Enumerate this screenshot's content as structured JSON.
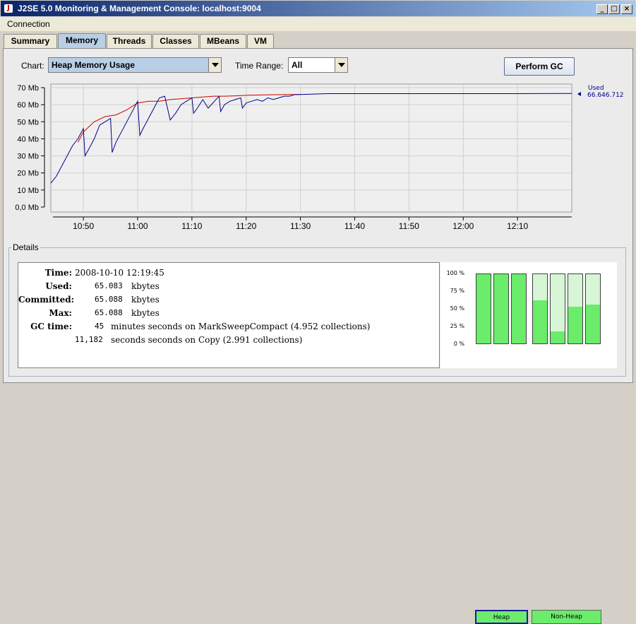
{
  "window": {
    "title": "J2SE 5.0 Monitoring & Management Console: localhost:9004",
    "icon": "java-icon"
  },
  "menu": {
    "items": [
      "Connection"
    ]
  },
  "tabs": [
    {
      "label": "Summary",
      "active": false
    },
    {
      "label": "Memory",
      "active": true
    },
    {
      "label": "Threads",
      "active": false
    },
    {
      "label": "Classes",
      "active": false
    },
    {
      "label": "MBeans",
      "active": false
    },
    {
      "label": "VM",
      "active": false
    }
  ],
  "controls": {
    "chart_label": "Chart:",
    "chart_value": "Heap Memory Usage",
    "time_range_label": "Time Range:",
    "time_range_value": "All",
    "gc_button": "Perform GC"
  },
  "chart_data": {
    "type": "line",
    "title": "",
    "xlabel": "",
    "ylabel": "",
    "y_ticks": [
      "70 Mb",
      "60 Mb",
      "50 Mb",
      "40 Mb",
      "30 Mb",
      "20 Mb",
      "10 Mb",
      "0,0 Mb"
    ],
    "y_tick_values": [
      70,
      60,
      50,
      40,
      30,
      20,
      10,
      0
    ],
    "x_ticks": [
      "10:50",
      "11:00",
      "11:10",
      "11:20",
      "11:30",
      "11:40",
      "11:50",
      "12:00",
      "12:10"
    ],
    "x_tick_minutes": [
      650,
      660,
      670,
      680,
      690,
      700,
      710,
      720,
      730
    ],
    "xlim_minutes": [
      644,
      740
    ],
    "ylim": [
      0,
      72
    ],
    "grid": true,
    "legend": {
      "label": "Used",
      "value": "66.646.712",
      "placement": "right"
    },
    "colors": {
      "used": "#00008b",
      "committed": "#cc0000"
    },
    "series": [
      {
        "name": "Used",
        "x": [
          644,
          645,
          646,
          647,
          648,
          649,
          650,
          650.3,
          651,
          652,
          653,
          654,
          655,
          655.3,
          656,
          657,
          658,
          659,
          660,
          660.4,
          661,
          662,
          663,
          664,
          665,
          666,
          667,
          668,
          670,
          670.3,
          671,
          672,
          673,
          675,
          675.3,
          676,
          677,
          678,
          679,
          679.3,
          680,
          681,
          682,
          683,
          684,
          685,
          686,
          687,
          688,
          689,
          690,
          695,
          700,
          710,
          720,
          730,
          740
        ],
        "y": [
          14,
          18,
          24,
          30,
          36,
          40,
          46,
          30,
          34,
          40,
          48,
          50,
          52,
          32,
          38,
          44,
          50,
          56,
          62,
          42,
          46,
          52,
          58,
          64,
          65,
          51,
          55,
          60,
          64,
          55,
          58,
          63,
          58,
          65,
          56,
          60,
          62,
          63,
          64,
          58,
          61,
          62,
          63,
          62,
          64,
          63,
          64,
          65,
          65,
          66,
          66,
          66.5,
          66.5,
          66.5,
          66.5,
          66.5,
          66.6
        ]
      },
      {
        "name": "Committed",
        "x": [
          649,
          650,
          652,
          654,
          656,
          658,
          660,
          662,
          664,
          666,
          668,
          670,
          672,
          674,
          676,
          678,
          680,
          684,
          688,
          690
        ],
        "y": [
          38,
          44,
          50,
          53,
          54,
          57,
          61,
          62,
          62,
          63,
          63.5,
          64,
          64.5,
          65,
          65,
          65.2,
          65.5,
          65.8,
          66,
          66
        ]
      }
    ]
  },
  "details": {
    "legend": "Details",
    "time_label": "Time:",
    "time_value": "2008-10-10 12:19:45",
    "used_label": "Used:",
    "used_value": "65.083",
    "used_unit": "kbytes",
    "committed_label": "Committed:",
    "committed_value": "65.088",
    "committed_unit": "kbytes",
    "max_label": "Max:",
    "max_value": "65.088",
    "max_unit": "kbytes",
    "gc_label": "GC time:",
    "gc1_value": "45",
    "gc1_text": "minutes seconds on MarkSweepCompact (4.952 collections)",
    "gc2_value": "11,182",
    "gc2_text": "seconds seconds on Copy (2.991 collections)"
  },
  "pools": {
    "pct_ticks": [
      "100 %",
      "75 %",
      "50 %",
      "25 %",
      "0 %"
    ],
    "heap_label": "Heap",
    "nonheap_label": "Non-Heap",
    "heap_fractions": [
      1.0,
      1.0,
      1.0
    ],
    "nonheap_fractions": [
      0.62,
      0.17,
      0.53,
      0.56
    ],
    "fill_color": "#6bec6b",
    "empty_color": "#d6f6d6"
  }
}
